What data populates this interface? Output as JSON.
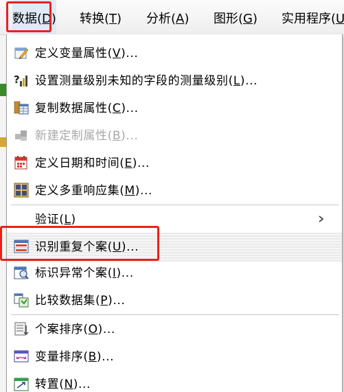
{
  "menubar": {
    "items": [
      {
        "label": "数据(",
        "mn": "D",
        "tail": ")"
      },
      {
        "label": "转换(",
        "mn": "T",
        "tail": ")"
      },
      {
        "label": "分析(",
        "mn": "A",
        "tail": ")"
      },
      {
        "label": "图形(",
        "mn": "G",
        "tail": ")"
      },
      {
        "label": "实用程序(",
        "mn": "U",
        "tail": ")"
      }
    ]
  },
  "menu": {
    "items": [
      {
        "label": "定义变量属性(",
        "mn": "V",
        "tail": ")...",
        "icon": "define-variable-properties-icon",
        "enabled": true
      },
      {
        "label": "设置测量级别未知的字段的测量级别(",
        "mn": "L",
        "tail": ")...",
        "icon": "measurement-level-question-icon",
        "enabled": true
      },
      {
        "label": "复制数据属性(",
        "mn": "C",
        "tail": ")...",
        "icon": "copy-data-properties-icon",
        "enabled": true
      },
      {
        "label": "新建定制属性(",
        "mn": "B",
        "tail": ")...",
        "icon": "new-custom-attribute-icon",
        "enabled": false
      },
      {
        "label": "定义日期和时间(",
        "mn": "E",
        "tail": ")...",
        "icon": "calendar-icon",
        "enabled": true
      },
      {
        "label": "定义多重响应集(",
        "mn": "M",
        "tail": ")...",
        "icon": "multiple-response-grid-icon",
        "enabled": true
      },
      {
        "label": "验证(",
        "mn": "L",
        "tail": ")",
        "icon": "",
        "enabled": true,
        "submenu": true
      },
      {
        "label": "识别重复个案(",
        "mn": "U",
        "tail": ")...",
        "icon": "identify-duplicates-icon",
        "enabled": true
      },
      {
        "label": "标识异常个案(",
        "mn": "I",
        "tail": ")...",
        "icon": "unusual-cases-icon",
        "enabled": true
      },
      {
        "label": "比较数据集(",
        "mn": "P",
        "tail": ")...",
        "icon": "compare-datasets-icon",
        "enabled": true
      },
      {
        "label": "个案排序(",
        "mn": "O",
        "tail": ")...",
        "icon": "sort-cases-icon",
        "enabled": true
      },
      {
        "label": "变量排序(",
        "mn": "B",
        "tail": ")...",
        "icon": "sort-variables-icon",
        "enabled": true
      },
      {
        "label": "转置(",
        "mn": "N",
        "tail": ")...",
        "icon": "transpose-icon",
        "enabled": true
      }
    ]
  },
  "colors": {
    "highlight_box": "#e8221a",
    "disabled_text": "#a8a8a8"
  }
}
